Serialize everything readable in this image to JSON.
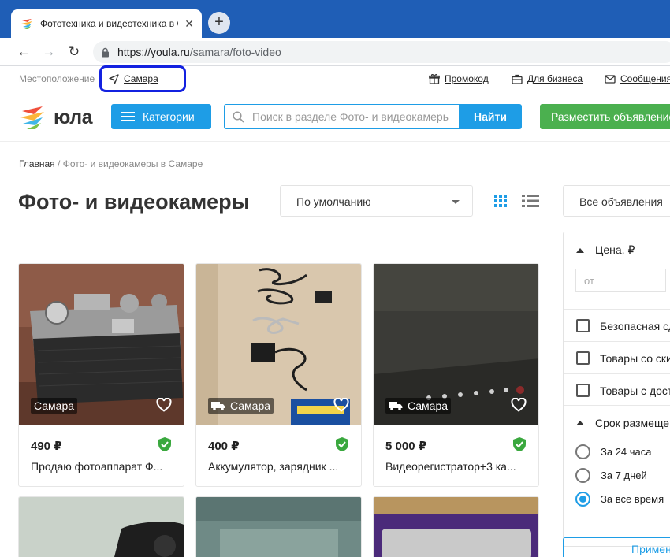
{
  "browser": {
    "tab_title": "Фототехника и видеотехника в Самаре",
    "url_host": "https://youla.ru",
    "url_path": "/samara/foto-video"
  },
  "topline": {
    "location_label": "Местоположение",
    "city": "Самара",
    "promo": "Промокод",
    "business": "Для бизнеса",
    "messages": "Сообщения"
  },
  "header": {
    "logo_text": "юла",
    "categories_label": "Категории",
    "search_placeholder": "Поиск в разделе Фото- и видеокамеры",
    "find_label": "Найти",
    "post_label": "Разместить объявление"
  },
  "breadcrumb": {
    "home": "Главная",
    "separator": " / ",
    "current": "Фото- и видеокамеры в Самаре"
  },
  "page": {
    "title": "Фото- и видеокамеры",
    "sort_value": "По умолчанию"
  },
  "products": [
    {
      "city": "Самара",
      "price": "490 ₽",
      "title": "Продаю фотоаппарат Ф...",
      "delivery": false
    },
    {
      "city": "Самара",
      "price": "400 ₽",
      "title": "Аккумулятор, зарядник ...",
      "delivery": true
    },
    {
      "city": "Самара",
      "price": "5 000 ₽",
      "title": "Видеорегистратор+3 ка...",
      "delivery": true
    }
  ],
  "filters": {
    "ads_type": "Все объявления",
    "price_heading": "Цена, ₽",
    "price_from_placeholder": "от",
    "checkboxes": [
      "Безопасная сделка",
      "Товары со скидкой",
      "Товары с доставкой"
    ],
    "period_heading": "Срок размещения",
    "periods": [
      "За 24 часа",
      "За 7 дней",
      "За все время"
    ],
    "selected_period": "За все время",
    "apply_label": "Применить"
  },
  "colors": {
    "browser_frame": "#1f5eb6",
    "accent_blue": "#1e9de6",
    "post_green": "#4bb04f",
    "verified_green": "#3aa83e",
    "annotation_ring": "#1321e0"
  }
}
